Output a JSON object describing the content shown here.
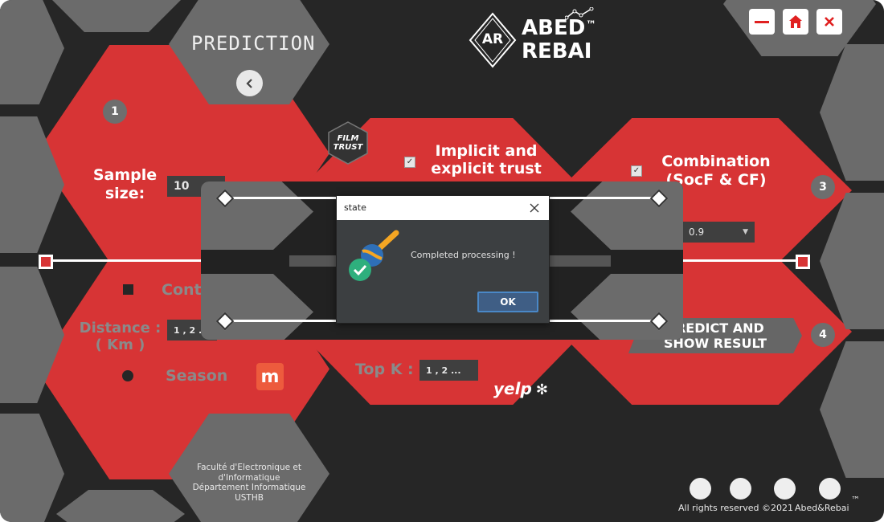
{
  "header": {
    "prediction_label": "PREDICTION",
    "brand_logo_text": "AR",
    "brand_name_line1": "ABED",
    "brand_name_line2": "REBAI",
    "brand_tm": "™"
  },
  "window_controls": {
    "minimize_icon": "minimize-icon",
    "home_icon": "home-icon",
    "close_icon": "close-icon"
  },
  "steps": {
    "one": "1",
    "three": "3",
    "four": "4"
  },
  "sample": {
    "label": "Sample size:",
    "value": "10"
  },
  "trust": {
    "label_line1": "Implicit and",
    "label_line2": "explicit trust",
    "checked": true,
    "filmtrust_line1": "FILM",
    "filmtrust_line2": "TRUST"
  },
  "combination": {
    "label_line1": "Combination",
    "label_line2": "(SocF & CF)",
    "checked": true,
    "select_value": "0.9"
  },
  "context": {
    "label": "Cont"
  },
  "distance": {
    "label_line1": "Distance :",
    "label_line2": "( Km )",
    "value": "1 , 2 ..."
  },
  "season": {
    "label": "Season"
  },
  "topk": {
    "label": "Top K :",
    "value": "1 , 2 ..."
  },
  "predict_button": {
    "line1": "PREDICT AND",
    "line2": "SHOW RESULT"
  },
  "logos": {
    "meetup_letter": "m",
    "yelp_text": "yelp"
  },
  "footer": {
    "university_line1": "Faculté d'Electronique et",
    "university_line2": "d'Informatique",
    "university_line3": "Département Informatique",
    "university_line4": "USTHB",
    "rights": "All rights reserved ©2021",
    "author": "Abed&Rebai",
    "tm": "™"
  },
  "dialog": {
    "title": "state",
    "message": "Completed processing !",
    "ok_label": "OK"
  },
  "colors": {
    "background": "#262626",
    "red": "#d73435",
    "grey": "#6b6b6b",
    "dialog_bg": "#3c3f41",
    "ok_border": "#4a88c7"
  }
}
